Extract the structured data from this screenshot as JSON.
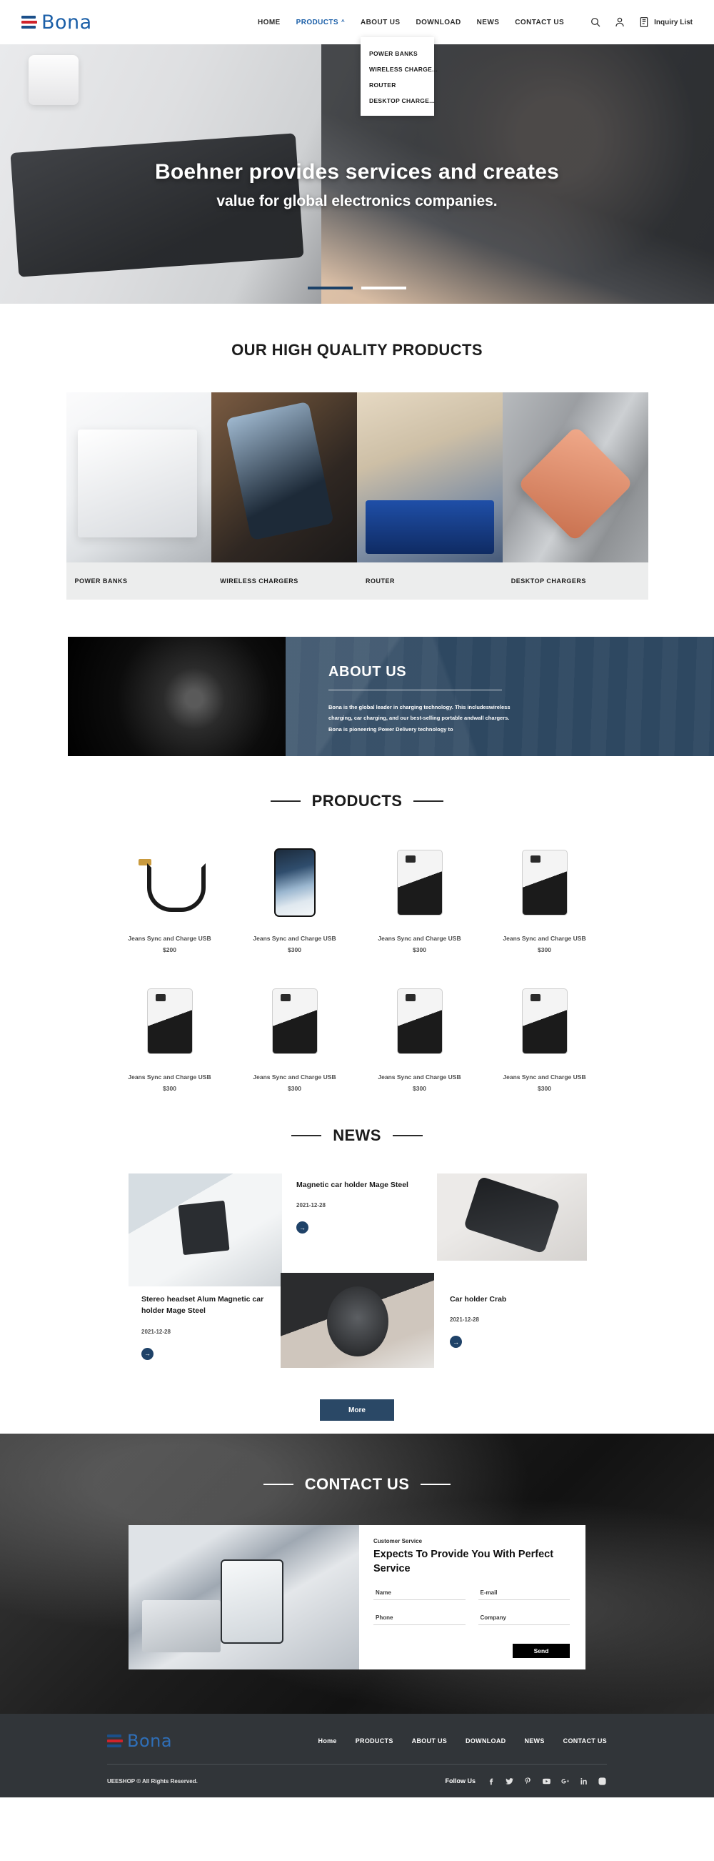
{
  "brand": {
    "name": "Bona"
  },
  "header": {
    "nav": [
      {
        "label": "HOME",
        "active": false,
        "caret": false
      },
      {
        "label": "PRODUCTS",
        "active": true,
        "caret": true
      },
      {
        "label": "ABOUT US",
        "active": false,
        "caret": false
      },
      {
        "label": "DOWNLOAD",
        "active": false,
        "caret": false
      },
      {
        "label": "NEWS",
        "active": false,
        "caret": false
      },
      {
        "label": "CONTACT US",
        "active": false,
        "caret": false
      }
    ],
    "icons": [
      "search-icon",
      "user-icon",
      "inquiry-list-icon"
    ],
    "inquiry_label": "Inquiry List",
    "dropdown": [
      {
        "label": "POWER BANKS"
      },
      {
        "label": "WIRELESS CHARGE..."
      },
      {
        "label": "ROUTER"
      },
      {
        "label": "DESKTOP CHARGE..."
      }
    ]
  },
  "hero": {
    "line1": "Boehner provides services and creates",
    "line2": "value for global electronics companies.",
    "slides": [
      {
        "active": true
      },
      {
        "active": false
      }
    ]
  },
  "categories_section": {
    "title": "OUR HIGH QUALITY PRODUCTS",
    "items": [
      {
        "label": "POWER BANKS"
      },
      {
        "label": "WIRELESS CHARGERS"
      },
      {
        "label": "ROUTER"
      },
      {
        "label": "DESKTOP CHARGERS"
      }
    ]
  },
  "about": {
    "title": "ABOUT US",
    "line1": "Bona is the global leader in charging technology. This includeswireless",
    "line2": "charging, car charging, and our best-selling portable andwall chargers.",
    "line3": "Bona is pioneering Power Delivery technology to"
  },
  "products_section": {
    "title": "PRODUCTS",
    "items": [
      {
        "name": "Jeans Sync and Charge USB",
        "price": "$200",
        "shape": "cable"
      },
      {
        "name": "Jeans Sync and Charge USB",
        "price": "$300",
        "shape": "phone"
      },
      {
        "name": "Jeans Sync and Charge USB",
        "price": "$300",
        "shape": "pbank"
      },
      {
        "name": "Jeans Sync and Charge USB",
        "price": "$300",
        "shape": "pbank"
      },
      {
        "name": "Jeans Sync and Charge USB",
        "price": "$300",
        "shape": "pbank"
      },
      {
        "name": "Jeans Sync and Charge USB",
        "price": "$300",
        "shape": "pbank"
      },
      {
        "name": "Jeans Sync and Charge USB",
        "price": "$300",
        "shape": "pbank"
      },
      {
        "name": "Jeans Sync and Charge USB",
        "price": "$300",
        "shape": "pbank"
      }
    ]
  },
  "news_section": {
    "title": "NEWS",
    "items": [
      {
        "title": "Magnetic car holder Mage Steel",
        "date": "2021-12-28"
      },
      {
        "title": "Stereo headset Alum Magnetic car holder Mage Steel",
        "date": "2021-12-28"
      },
      {
        "title": "Car holder Crab",
        "date": "2021-12-28"
      }
    ],
    "more_label": "More"
  },
  "contact_section": {
    "title": "CONTACT US",
    "kicker": "Customer Service",
    "headline": "Expects To Provide You With Perfect Service",
    "fields": [
      {
        "placeholder": "Name",
        "value": ""
      },
      {
        "placeholder": "E-mail",
        "value": ""
      },
      {
        "placeholder": "Phone",
        "value": ""
      },
      {
        "placeholder": "Company",
        "value": ""
      }
    ],
    "send_label": "Send"
  },
  "footer": {
    "nav": [
      "Home",
      "PRODUCTS",
      "ABOUT US",
      "DOWNLOAD",
      "NEWS",
      "CONTACT US"
    ],
    "copyright": "UEESHOP © All Rights Reserved.",
    "follow_label": "Follow Us",
    "social": [
      "facebook-icon",
      "twitter-icon",
      "pinterest-icon",
      "youtube-icon",
      "google-plus-icon",
      "linkedin-icon",
      "instagram-icon"
    ]
  },
  "colors": {
    "brand_blue": "#1b5fa8",
    "brand_red": "#d0232b",
    "panel_navy": "#2e4861",
    "footer_bg": "#313539"
  }
}
